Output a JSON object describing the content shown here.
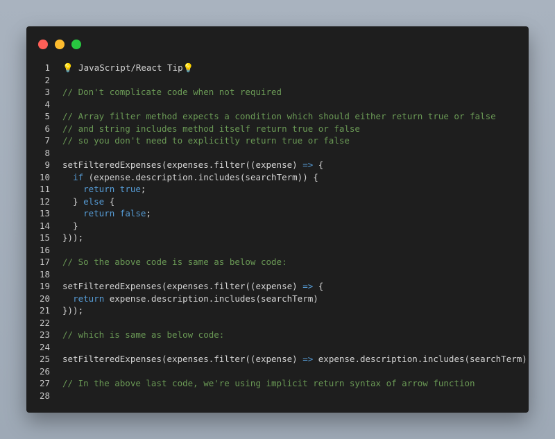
{
  "window": {
    "controls": [
      {
        "name": "close",
        "color": "#ff5f57"
      },
      {
        "name": "minimize",
        "color": "#febc2e"
      },
      {
        "name": "maximize",
        "color": "#28c840"
      }
    ]
  },
  "lines": [
    {
      "n": "1",
      "tokens": [
        {
          "t": "💡 JavaScript/React Tip💡",
          "c": "plain"
        }
      ]
    },
    {
      "n": "2",
      "tokens": []
    },
    {
      "n": "3",
      "tokens": [
        {
          "t": "// Don't complicate code when not required",
          "c": "comment"
        }
      ]
    },
    {
      "n": "4",
      "tokens": []
    },
    {
      "n": "5",
      "tokens": [
        {
          "t": "// Array filter method expects a condition which should either return true or false",
          "c": "comment"
        }
      ]
    },
    {
      "n": "6",
      "tokens": [
        {
          "t": "// and string includes method itself return true or false",
          "c": "comment"
        }
      ]
    },
    {
      "n": "7",
      "tokens": [
        {
          "t": "// so you don't need to explicitly return true or false",
          "c": "comment"
        }
      ]
    },
    {
      "n": "8",
      "tokens": []
    },
    {
      "n": "9",
      "tokens": [
        {
          "t": "setFilteredExpenses(expenses.filter((expense) ",
          "c": "plain"
        },
        {
          "t": "=>",
          "c": "keyword"
        },
        {
          "t": " {",
          "c": "plain"
        }
      ]
    },
    {
      "n": "10",
      "tokens": [
        {
          "t": "  ",
          "c": "plain"
        },
        {
          "t": "if",
          "c": "keyword"
        },
        {
          "t": " (expense.description.includes(searchTerm)) {",
          "c": "plain"
        }
      ]
    },
    {
      "n": "11",
      "tokens": [
        {
          "t": "    ",
          "c": "plain"
        },
        {
          "t": "return",
          "c": "keyword"
        },
        {
          "t": " ",
          "c": "plain"
        },
        {
          "t": "true",
          "c": "keyword"
        },
        {
          "t": ";",
          "c": "plain"
        }
      ]
    },
    {
      "n": "12",
      "tokens": [
        {
          "t": "  } ",
          "c": "plain"
        },
        {
          "t": "else",
          "c": "keyword"
        },
        {
          "t": " {",
          "c": "plain"
        }
      ]
    },
    {
      "n": "13",
      "tokens": [
        {
          "t": "    ",
          "c": "plain"
        },
        {
          "t": "return",
          "c": "keyword"
        },
        {
          "t": " ",
          "c": "plain"
        },
        {
          "t": "false",
          "c": "keyword"
        },
        {
          "t": ";",
          "c": "plain"
        }
      ]
    },
    {
      "n": "14",
      "tokens": [
        {
          "t": "  }",
          "c": "plain"
        }
      ]
    },
    {
      "n": "15",
      "tokens": [
        {
          "t": "}));",
          "c": "plain"
        }
      ]
    },
    {
      "n": "16",
      "tokens": []
    },
    {
      "n": "17",
      "tokens": [
        {
          "t": "// So the above code is same as below code:",
          "c": "comment"
        }
      ]
    },
    {
      "n": "18",
      "tokens": []
    },
    {
      "n": "19",
      "tokens": [
        {
          "t": "setFilteredExpenses(expenses.filter((expense) ",
          "c": "plain"
        },
        {
          "t": "=>",
          "c": "keyword"
        },
        {
          "t": " {",
          "c": "plain"
        }
      ]
    },
    {
      "n": "20",
      "tokens": [
        {
          "t": "  ",
          "c": "plain"
        },
        {
          "t": "return",
          "c": "keyword"
        },
        {
          "t": " expense.description.includes(searchTerm)",
          "c": "plain"
        }
      ]
    },
    {
      "n": "21",
      "tokens": [
        {
          "t": "}));",
          "c": "plain"
        }
      ]
    },
    {
      "n": "22",
      "tokens": []
    },
    {
      "n": "23",
      "tokens": [
        {
          "t": "// which is same as below code:",
          "c": "comment"
        }
      ]
    },
    {
      "n": "24",
      "tokens": []
    },
    {
      "n": "25",
      "tokens": [
        {
          "t": "setFilteredExpenses(expenses.filter((expense) ",
          "c": "plain"
        },
        {
          "t": "=>",
          "c": "keyword"
        },
        {
          "t": " expense.description.includes(searchTerm)));",
          "c": "plain"
        }
      ]
    },
    {
      "n": "26",
      "tokens": []
    },
    {
      "n": "27",
      "tokens": [
        {
          "t": "// In the above last code, we're using implicit return syntax of arrow function",
          "c": "comment"
        }
      ]
    },
    {
      "n": "28",
      "tokens": []
    }
  ]
}
